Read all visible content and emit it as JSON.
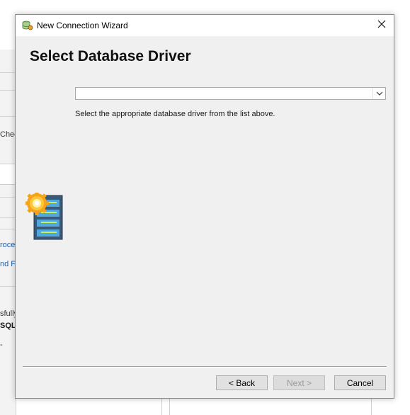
{
  "background": {
    "fragments": [
      "Chec",
      "roce",
      "nd Fi",
      "sfully",
      "SQL",
      "-"
    ]
  },
  "window": {
    "title": "New Connection Wizard",
    "icon": "database-wizard-icon",
    "close_icon": "close-icon"
  },
  "page": {
    "heading": "Select Database Driver",
    "driver_select": {
      "value": "",
      "arrow_icon": "chevron-down-icon"
    },
    "hint": "Select the appropriate database driver from the list above.",
    "side_art_icon": "database-server-gear-icon"
  },
  "buttons": {
    "back": "< Back",
    "next": "Next >",
    "cancel": "Cancel"
  },
  "colors": {
    "dialog_bg": "#f0f0f0",
    "titlebar_bg": "#ffffff",
    "link": "#1c5fb0"
  }
}
